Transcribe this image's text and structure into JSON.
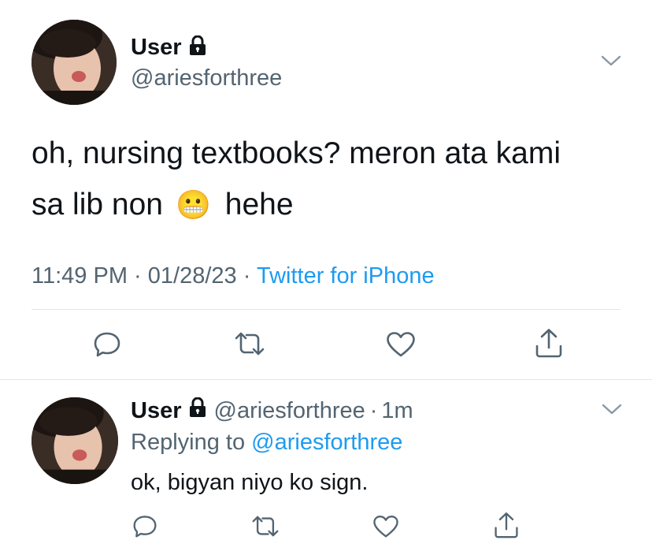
{
  "main_tweet": {
    "name": "User",
    "handle": "@ariesforthree",
    "text_line1": "oh, nursing textbooks? meron ata kami",
    "text_line2_a": "sa lib non",
    "emoji": "😬",
    "text_line2_b": "hehe",
    "time": "11:49 PM",
    "date": "01/28/23",
    "source": "Twitter for iPhone",
    "sep": "·"
  },
  "reply": {
    "name": "User",
    "handle": "@ariesforthree",
    "age": "1m",
    "sep": "·",
    "replying_label": "Replying to",
    "replying_handle": "@ariesforthree",
    "text": "ok, bigyan niyo ko sign."
  },
  "icons": {
    "lock": "lock-icon",
    "more": "chevron-down-icon",
    "reply": "reply-icon",
    "retweet": "retweet-icon",
    "like": "heart-icon",
    "share": "share-icon"
  },
  "colors": {
    "text": "#0f1419",
    "secondary": "#536471",
    "link": "#1d9bf0",
    "divider": "#e1e6ea"
  }
}
